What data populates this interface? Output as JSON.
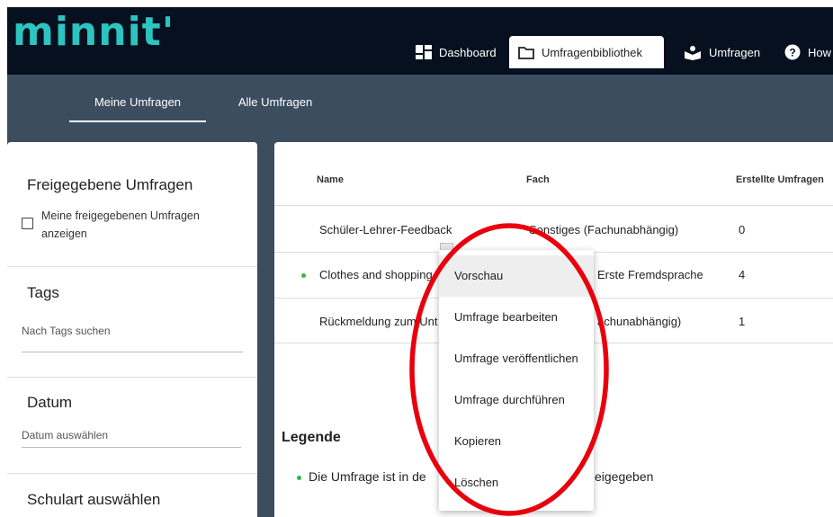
{
  "app": {
    "logo_text": "minnit'"
  },
  "topnav": [
    {
      "label": "Dashboard",
      "icon": "dashboard-icon",
      "active": false
    },
    {
      "label": "Umfragenbibliothek",
      "icon": "folder-icon",
      "active": true
    },
    {
      "label": "Umfragen",
      "icon": "survey-icon",
      "active": false
    },
    {
      "label": "How",
      "icon": "help-icon",
      "active": false
    }
  ],
  "subnav": {
    "tabs": [
      {
        "label": "Meine Umfragen",
        "active": true
      },
      {
        "label": "Alle Umfragen",
        "active": false
      }
    ]
  },
  "filters": {
    "shared": {
      "title": "Freigegebene Umfragen",
      "checkbox_label": "Meine freigegebenen Umfragen anzeigen",
      "checked": false
    },
    "tags": {
      "title": "Tags",
      "placeholder": "Nach Tags suchen"
    },
    "date": {
      "title": "Datum",
      "placeholder": "Datum auswählen"
    },
    "school": {
      "title": "Schulart auswählen"
    }
  },
  "table": {
    "columns": [
      "Name",
      "Fach",
      "Erstellte Umfragen"
    ],
    "rows": [
      {
        "name": "Schüler-Lehrer-Feedback",
        "fach": "Sonstiges (Fachunabhängig)",
        "count": "0",
        "shared": false
      },
      {
        "name": "Clothes and shopping",
        "fach": "Erste Fremdsprache",
        "count": "4",
        "shared": true
      },
      {
        "name": "Rückmeldung zum Unt",
        "fach": "achunabhängig)",
        "count": "1",
        "shared": false
      }
    ]
  },
  "legend": {
    "title": "Legende",
    "item_start": "Die Umfrage ist in de",
    "item_end": "eigegeben"
  },
  "context_menu": {
    "items": [
      "Vorschau",
      "Umfrage bearbeiten",
      "Umfrage veröffentlichen",
      "Umfrage durchführen",
      "Kopieren",
      "Löschen"
    ],
    "hovered": "Vorschau"
  },
  "colors": {
    "brand": "#2cc4c0",
    "topbar": "#06101e",
    "subbar": "#3c4d60",
    "status_dot": "#36b34a",
    "annotation": "#e8000c"
  }
}
